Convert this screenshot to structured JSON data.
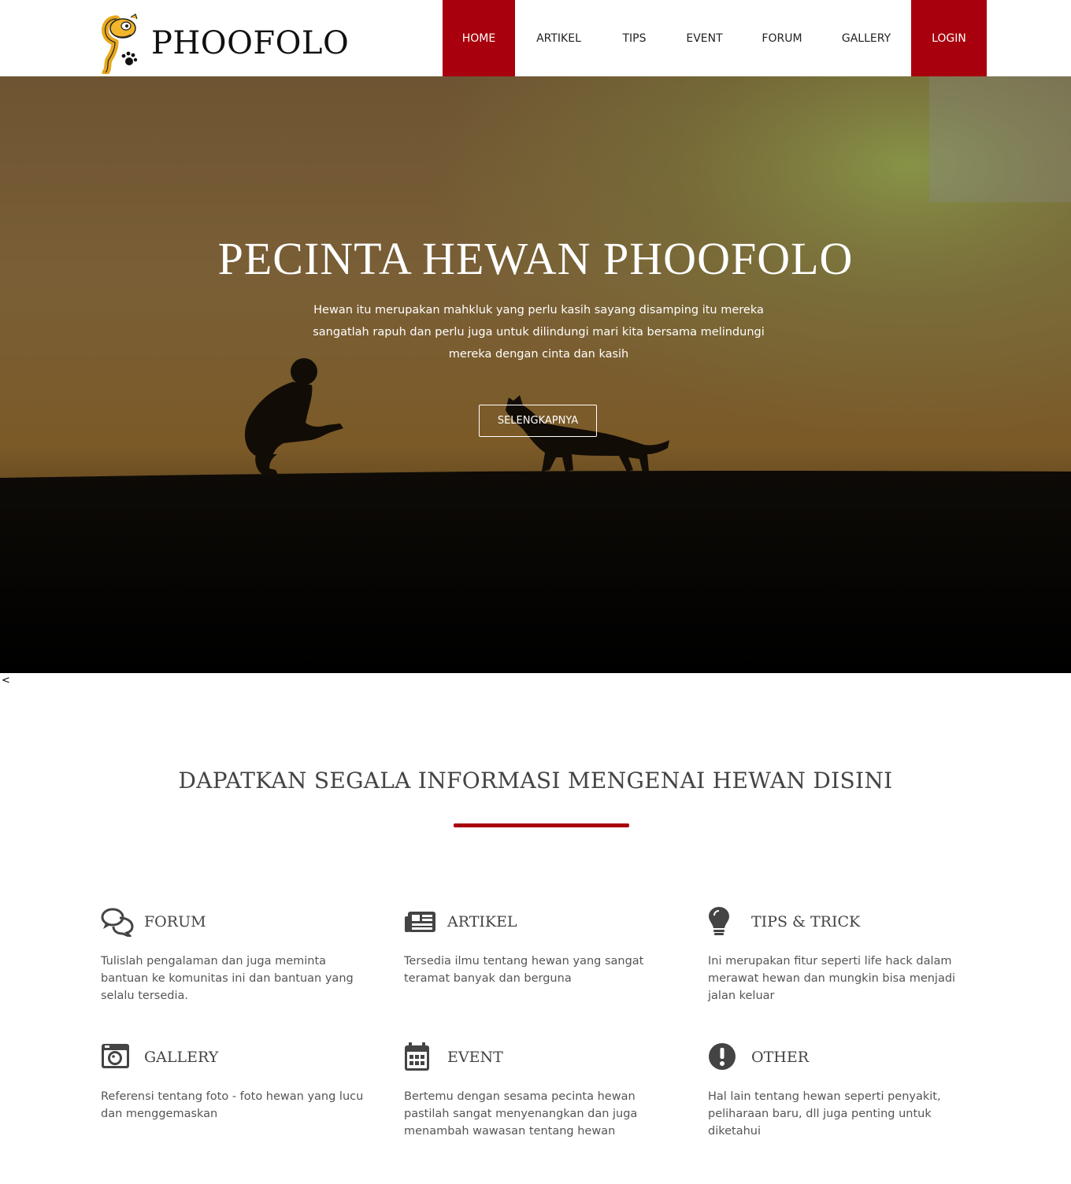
{
  "brand": {
    "name": "PHOOFOLO"
  },
  "nav": [
    {
      "label": "HOME"
    },
    {
      "label": "ARTIKEL"
    },
    {
      "label": "TIPS"
    },
    {
      "label": "EVENT"
    },
    {
      "label": "FORUM"
    },
    {
      "label": "GALLERY"
    },
    {
      "label": "LOGIN"
    }
  ],
  "hero": {
    "title": "PECINTA HEWAN PHOOFOLO",
    "text": "Hewan itu merupakan mahkluk yang perlu kasih sayang disamping itu mereka sangatlah rapuh dan perlu juga untuk dilindungi mari kita bersama melindungi mereka dengan cinta dan kasih",
    "button": "SELENGKAPNYA"
  },
  "stray_text": "<",
  "features": {
    "title": "DAPATKAN SEGALA INFORMASI MENGENAI HEWAN DISINI",
    "items": [
      {
        "icon": "comments-icon",
        "title": "FORUM",
        "desc": "Tulislah pengalaman dan juga meminta bantuan ke komunitas ini dan bantuan yang selalu tersedia."
      },
      {
        "icon": "newspaper-icon",
        "title": "ARTIKEL",
        "desc": "Tersedia ilmu tentang hewan yang sangat teramat banyak dan berguna"
      },
      {
        "icon": "lightbulb-icon",
        "title": "TIPS & TRICK",
        "desc": "Ini merupakan fitur seperti life hack dalam merawat hewan dan mungkin bisa menjadi jalan keluar"
      },
      {
        "icon": "camera-icon",
        "title": "GALLERY",
        "desc": "Referensi tentang foto - foto hewan yang lucu dan menggemaskan"
      },
      {
        "icon": "calendar-icon",
        "title": "EVENT",
        "desc": "Bertemu dengan sesama pecinta hewan pastilah sangat menyenangkan dan juga menambah wawasan tentang hewan"
      },
      {
        "icon": "exclamation-circle-icon",
        "title": "OTHER",
        "desc": "Hal lain tentang hewan seperti penyakit, peliharaan baru, dll juga penting untuk diketahui"
      }
    ]
  }
}
